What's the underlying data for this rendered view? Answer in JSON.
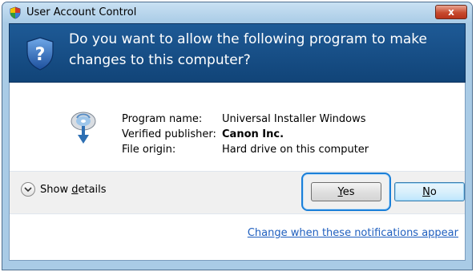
{
  "window": {
    "title": "User Account Control",
    "close_label": "x"
  },
  "banner": {
    "question": "Do you want to allow the following program to make changes to this computer?"
  },
  "details": [
    {
      "label": "Program name:",
      "value": "Universal Installer Windows"
    },
    {
      "label": "Verified publisher:",
      "value": "Canon Inc."
    },
    {
      "label": "File origin:",
      "value": "Hard drive on this computer"
    }
  ],
  "actions": {
    "show_details_pre": "Show ",
    "show_details_mnemonic": "d",
    "show_details_post": "etails",
    "yes_mnemonic": "Y",
    "yes_rest": "es",
    "no_mnemonic": "N",
    "no_rest": "o"
  },
  "footer": {
    "link": "Change when these notifications appear"
  },
  "colors": {
    "banner": "#114478",
    "frame": "#a9cbe6",
    "focus": "#1a7fd8",
    "link": "#1f5fbf"
  }
}
